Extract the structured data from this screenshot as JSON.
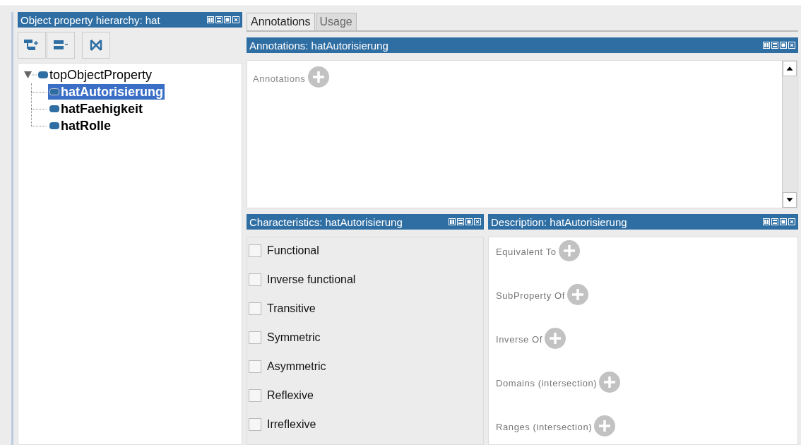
{
  "hierarchy_panel": {
    "title": "Object property hierarchy: hat",
    "tree": [
      {
        "label": "topObjectProperty",
        "expanded": true,
        "selected": false,
        "children": [
          {
            "label": "hatAutorisierung",
            "selected": true
          },
          {
            "label": "hatFaehigkeit",
            "selected": false
          },
          {
            "label": "hatRolle",
            "selected": false
          }
        ]
      }
    ]
  },
  "tabs": [
    {
      "label": "Annotations",
      "selected": true
    },
    {
      "label": "Usage",
      "selected": false
    }
  ],
  "annotations_panel": {
    "title": "Annotations: hatAutorisierung",
    "add_label": "Annotations"
  },
  "characteristics_panel": {
    "title": "Characteristics: hatAutorisierung",
    "items": [
      {
        "label": "Functional",
        "checked": false
      },
      {
        "label": "Inverse functional",
        "checked": false
      },
      {
        "label": "Transitive",
        "checked": false
      },
      {
        "label": "Symmetric",
        "checked": false
      },
      {
        "label": "Asymmetric",
        "checked": false
      },
      {
        "label": "Reflexive",
        "checked": false
      },
      {
        "label": "Irreflexive",
        "checked": false
      }
    ]
  },
  "description_panel": {
    "title": "Description: hatAutorisierung",
    "sections": [
      "Equivalent To",
      "SubProperty Of",
      "Inverse Of",
      "Domains (intersection)",
      "Ranges (intersection)"
    ]
  }
}
